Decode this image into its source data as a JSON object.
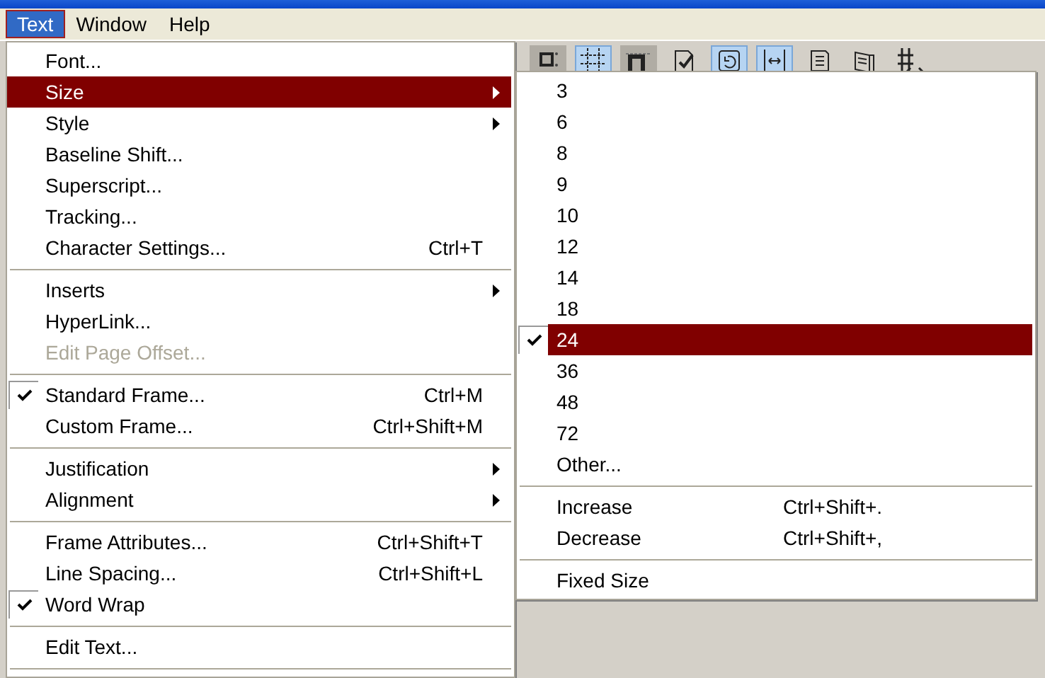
{
  "menu_bar": [
    {
      "label": "Text",
      "selected": true
    },
    {
      "label": "Window",
      "selected": false
    },
    {
      "label": "Help",
      "selected": false
    }
  ],
  "toolbar": [
    {
      "selected": false,
      "pressed": true
    },
    {
      "selected": true,
      "pressed": false
    },
    {
      "selected": false,
      "pressed": true
    },
    {
      "selected": false,
      "pressed": false
    },
    {
      "selected": true,
      "pressed": false
    },
    {
      "selected": true,
      "pressed": false
    },
    {
      "selected": false,
      "pressed": false
    },
    {
      "selected": false,
      "pressed": false
    },
    {
      "selected": false,
      "pressed": false
    }
  ],
  "menu": {
    "items": [
      {
        "kind": "item",
        "label": "Font...",
        "checked": false,
        "disabled": false,
        "selected": false,
        "submenu": false
      },
      {
        "kind": "item",
        "label": "Size",
        "checked": false,
        "disabled": false,
        "selected": true,
        "submenu": true
      },
      {
        "kind": "item",
        "label": "Style",
        "checked": false,
        "disabled": false,
        "selected": false,
        "submenu": true
      },
      {
        "kind": "item",
        "label": "Baseline Shift...",
        "checked": false,
        "disabled": false,
        "selected": false,
        "submenu": false
      },
      {
        "kind": "item",
        "label": "Superscript...",
        "checked": false,
        "disabled": false,
        "selected": false,
        "submenu": false
      },
      {
        "kind": "item",
        "label": "Tracking...",
        "checked": false,
        "disabled": false,
        "selected": false,
        "submenu": false
      },
      {
        "kind": "item",
        "label": "Character Settings...",
        "shortcut": "Ctrl+T",
        "checked": false,
        "disabled": false,
        "selected": false,
        "submenu": false
      },
      {
        "kind": "separator"
      },
      {
        "kind": "item",
        "label": "Inserts",
        "checked": false,
        "disabled": false,
        "selected": false,
        "submenu": true
      },
      {
        "kind": "item",
        "label": "HyperLink...",
        "checked": false,
        "disabled": false,
        "selected": false,
        "submenu": false
      },
      {
        "kind": "item",
        "label": "Edit Page Offset...",
        "checked": false,
        "disabled": true,
        "selected": false,
        "submenu": false
      },
      {
        "kind": "separator"
      },
      {
        "kind": "item",
        "label": "Standard Frame...",
        "shortcut": "Ctrl+M",
        "checked": true,
        "disabled": false,
        "selected": false,
        "submenu": false
      },
      {
        "kind": "item",
        "label": "Custom Frame...",
        "shortcut": "Ctrl+Shift+M",
        "checked": false,
        "disabled": false,
        "selected": false,
        "submenu": false
      },
      {
        "kind": "separator"
      },
      {
        "kind": "item",
        "label": "Justification",
        "checked": false,
        "disabled": false,
        "selected": false,
        "submenu": true
      },
      {
        "kind": "item",
        "label": "Alignment",
        "checked": false,
        "disabled": false,
        "selected": false,
        "submenu": true
      },
      {
        "kind": "separator"
      },
      {
        "kind": "item",
        "label": "Frame Attributes...",
        "shortcut": "Ctrl+Shift+T",
        "checked": false,
        "disabled": false,
        "selected": false,
        "submenu": false
      },
      {
        "kind": "item",
        "label": "Line Spacing...",
        "shortcut": "Ctrl+Shift+L",
        "checked": false,
        "disabled": false,
        "selected": false,
        "submenu": false
      },
      {
        "kind": "item",
        "label": "Word Wrap",
        "checked": true,
        "disabled": false,
        "selected": false,
        "submenu": false
      },
      {
        "kind": "separator"
      },
      {
        "kind": "item",
        "label": "Edit Text...",
        "checked": false,
        "disabled": false,
        "selected": false,
        "submenu": false
      },
      {
        "kind": "separator"
      }
    ]
  },
  "submenu": {
    "items": [
      {
        "kind": "item",
        "label": "3",
        "checked": false,
        "selected": false
      },
      {
        "kind": "item",
        "label": "6",
        "checked": false,
        "selected": false
      },
      {
        "kind": "item",
        "label": "8",
        "checked": false,
        "selected": false
      },
      {
        "kind": "item",
        "label": "9",
        "checked": false,
        "selected": false
      },
      {
        "kind": "item",
        "label": "10",
        "checked": false,
        "selected": false
      },
      {
        "kind": "item",
        "label": "12",
        "checked": false,
        "selected": false
      },
      {
        "kind": "item",
        "label": "14",
        "checked": false,
        "selected": false
      },
      {
        "kind": "item",
        "label": "18",
        "checked": false,
        "selected": false
      },
      {
        "kind": "item",
        "label": "24",
        "checked": true,
        "selected": true
      },
      {
        "kind": "item",
        "label": "36",
        "checked": false,
        "selected": false
      },
      {
        "kind": "item",
        "label": "48",
        "checked": false,
        "selected": false
      },
      {
        "kind": "item",
        "label": "72",
        "checked": false,
        "selected": false
      },
      {
        "kind": "item",
        "label": "Other...",
        "checked": false,
        "selected": false
      },
      {
        "kind": "separator"
      },
      {
        "kind": "item",
        "label": "Increase",
        "shortcut": "Ctrl+Shift+.",
        "checked": false,
        "selected": false
      },
      {
        "kind": "item",
        "label": "Decrease",
        "shortcut": "Ctrl+Shift+,",
        "checked": false,
        "selected": false
      },
      {
        "kind": "separator"
      },
      {
        "kind": "item",
        "label": "Fixed Size",
        "checked": false,
        "selected": false
      }
    ]
  }
}
